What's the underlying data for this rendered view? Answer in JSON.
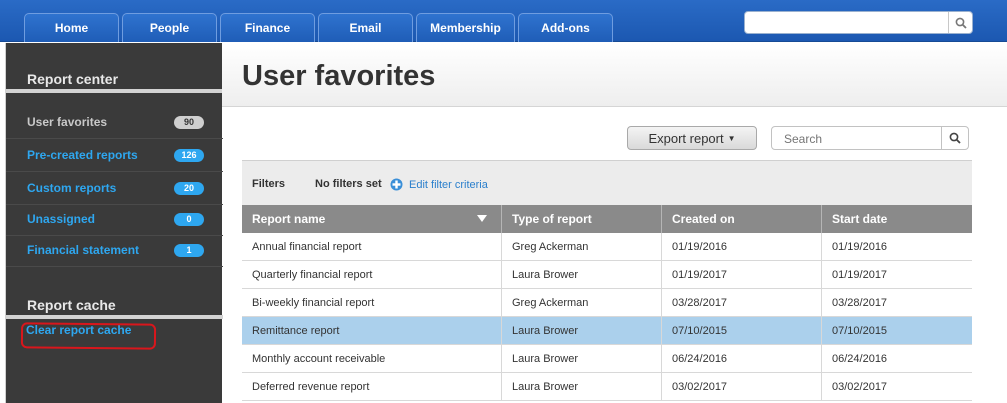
{
  "nav": {
    "tabs": [
      "Home",
      "People",
      "Finance",
      "Email",
      "Membership",
      "Add-ons"
    ]
  },
  "global_search": {
    "value": "",
    "placeholder": ""
  },
  "sidebar": {
    "report_center_heading": "Report center",
    "items": [
      {
        "label": "User favorites",
        "count": "90",
        "active": true
      },
      {
        "label": "Pre-created reports",
        "count": "126",
        "active": false
      },
      {
        "label": "Custom reports",
        "count": "20",
        "active": false
      },
      {
        "label": "Unassigned",
        "count": "0",
        "active": false
      },
      {
        "label": "Financial statement",
        "count": "1",
        "active": false
      }
    ],
    "report_cache_heading": "Report cache",
    "clear_cache_label": "Clear report cache"
  },
  "main": {
    "title": "User favorites",
    "export_label": "Export report",
    "search_placeholder": "Search",
    "filters_label": "Filters",
    "filters_value": "No filters set",
    "edit_filters_label": "Edit filter criteria"
  },
  "table": {
    "columns": [
      "Report name",
      "Type of report",
      "Created on",
      "Start date"
    ],
    "rows": [
      [
        "Annual financial report",
        "Greg Ackerman",
        "01/19/2016",
        "01/19/2016"
      ],
      [
        "Quarterly financial report",
        "Laura Brower",
        "01/19/2017",
        "01/19/2017"
      ],
      [
        "Bi-weekly financial report",
        "Greg Ackerman",
        "03/28/2017",
        "03/28/2017"
      ],
      [
        "Remittance report",
        "Laura Brower",
        "07/10/2015",
        "07/10/2015"
      ],
      [
        "Monthly account receivable",
        "Laura Brower",
        "06/24/2016",
        "06/24/2016"
      ],
      [
        "Deferred revenue report",
        "Laura Brower",
        "03/02/2017",
        "03/02/2017"
      ]
    ],
    "selected_row": 3
  },
  "colors": {
    "nav_blue": "#1c58b1",
    "link_blue": "#2ea7f0",
    "sidebar_bg": "#3a3a3a",
    "header_grey": "#8a8a8a",
    "selected_row": "#abd0ec",
    "annotation_red": "#d9161c"
  }
}
